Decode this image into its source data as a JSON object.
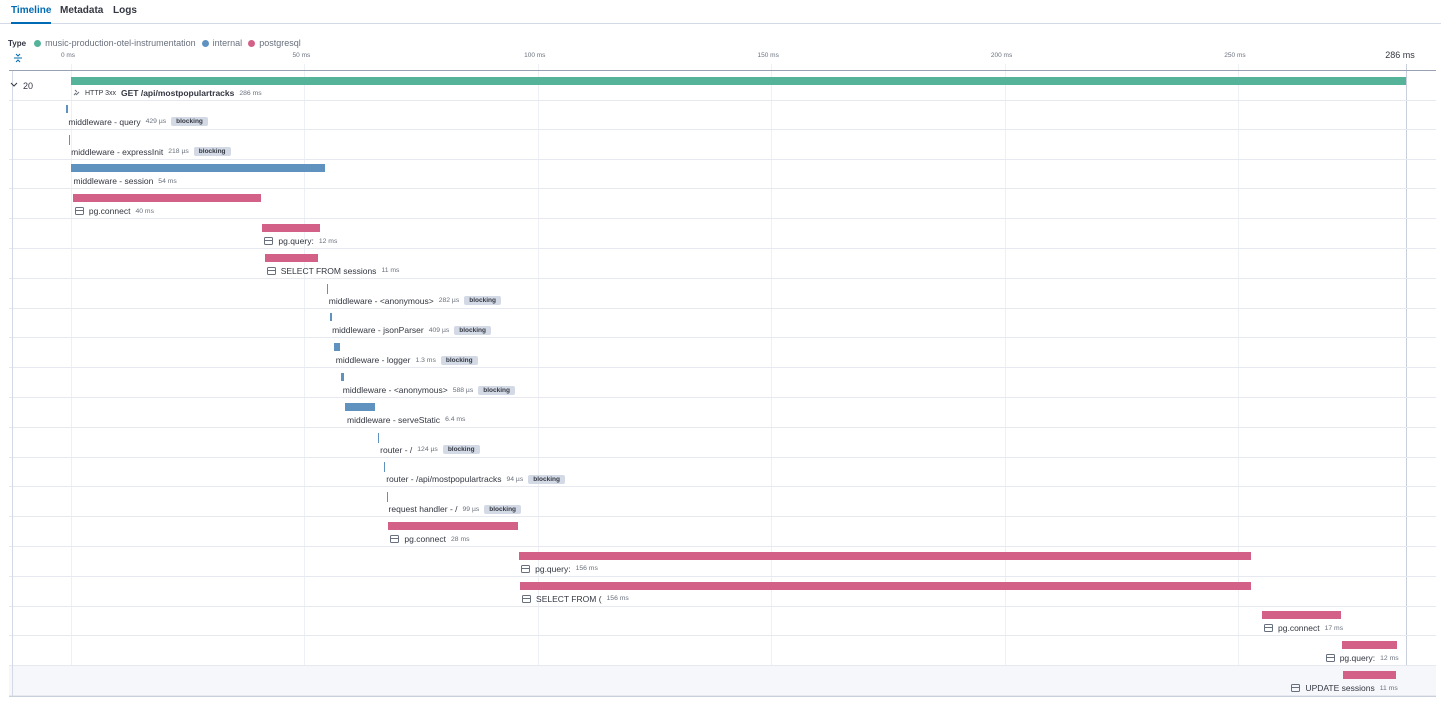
{
  "tabs": [
    {
      "label": "Timeline",
      "selected": true
    },
    {
      "label": "Metadata",
      "selected": false
    },
    {
      "label": "Logs",
      "selected": false
    }
  ],
  "legend": {
    "label": "Type",
    "items": [
      {
        "name": "music-production-otel-instrumentation",
        "color": "#54b399"
      },
      {
        "name": "internal",
        "color": "#6092c0"
      },
      {
        "name": "postgresql",
        "color": "#d36086"
      }
    ]
  },
  "colors": {
    "service": "#54b399",
    "internal": "#6092c0",
    "postgresql": "#d36086"
  },
  "timeline": {
    "total_ms": 286,
    "ticks": [
      {
        "label": "0 ms",
        "ms": 0
      },
      {
        "label": "50 ms",
        "ms": 50
      },
      {
        "label": "100 ms",
        "ms": 100
      },
      {
        "label": "150 ms",
        "ms": 150
      },
      {
        "label": "200 ms",
        "ms": 200
      },
      {
        "label": "250 ms",
        "ms": 250
      }
    ],
    "end_label": "286 ms"
  },
  "root_toggle": {
    "count": "20",
    "icon": "chevron-down-icon"
  },
  "spans": [
    {
      "name": "GET /api/mostpopulartracks",
      "status": "HTTP 3xx",
      "duration": "286 ms",
      "start_ms": 0,
      "duration_ms": 286,
      "type": "service",
      "icon": "http-icon",
      "blocking": false,
      "strong": true
    },
    {
      "name": "middleware - query",
      "duration": "429 µs",
      "start_ms": -1.0,
      "duration_ms": 0.429,
      "type": "internal",
      "icon": "",
      "blocking": true
    },
    {
      "name": "middleware - expressInit",
      "duration": "218 µs",
      "start_ms": -0.4,
      "duration_ms": 0.218,
      "type": "internal",
      "icon": "",
      "blocking": true
    },
    {
      "name": "middleware - session",
      "duration": "54 ms",
      "start_ms": 0.1,
      "duration_ms": 54.3,
      "type": "internal",
      "icon": "",
      "blocking": false
    },
    {
      "name": "pg.connect",
      "duration": "40 ms",
      "start_ms": 0.4,
      "duration_ms": 40.4,
      "type": "postgresql",
      "icon": "database-icon",
      "blocking": false
    },
    {
      "name": "pg.query:",
      "duration": "12 ms",
      "start_ms": 41.0,
      "duration_ms": 12.4,
      "type": "postgresql",
      "icon": "database-icon",
      "blocking": false
    },
    {
      "name": "SELECT FROM sessions",
      "duration": "11 ms",
      "start_ms": 41.5,
      "duration_ms": 11.4,
      "type": "postgresql",
      "icon": "database-icon",
      "blocking": false
    },
    {
      "name": "middleware - <anonymous>",
      "duration": "282 µs",
      "start_ms": 54.8,
      "duration_ms": 0.282,
      "type": "internal",
      "icon": "",
      "blocking": true
    },
    {
      "name": "middleware - jsonParser",
      "duration": "409 µs",
      "start_ms": 55.5,
      "duration_ms": 0.409,
      "type": "internal",
      "icon": "",
      "blocking": true
    },
    {
      "name": "middleware - logger",
      "duration": "1.3 ms",
      "start_ms": 56.3,
      "duration_ms": 1.3,
      "type": "internal",
      "icon": "",
      "blocking": true
    },
    {
      "name": "middleware - <anonymous>",
      "duration": "588 µs",
      "start_ms": 57.8,
      "duration_ms": 0.588,
      "type": "internal",
      "icon": "",
      "blocking": true
    },
    {
      "name": "middleware - serveStatic",
      "duration": "6.4 ms",
      "start_ms": 58.7,
      "duration_ms": 6.4,
      "type": "internal",
      "icon": "",
      "blocking": false
    },
    {
      "name": "router - /",
      "duration": "124 µs",
      "start_ms": 65.8,
      "duration_ms": 0.124,
      "type": "internal",
      "icon": "",
      "blocking": true
    },
    {
      "name": "router - /api/mostpopulartracks",
      "duration": "94 µs",
      "start_ms": 67.1,
      "duration_ms": 0.094,
      "type": "internal",
      "icon": "",
      "blocking": true
    },
    {
      "name": "request handler - /",
      "duration": "99 µs",
      "start_ms": 67.6,
      "duration_ms": 0.099,
      "type": "internal",
      "icon": "",
      "blocking": true
    },
    {
      "name": "pg.connect",
      "duration": "28 ms",
      "start_ms": 68.0,
      "duration_ms": 27.7,
      "type": "postgresql",
      "icon": "database-icon",
      "blocking": false
    },
    {
      "name": "pg.query:",
      "duration": "156 ms",
      "start_ms": 96.0,
      "duration_ms": 156.9,
      "type": "postgresql",
      "icon": "database-icon",
      "blocking": false
    },
    {
      "name": "SELECT FROM (",
      "duration": "156 ms",
      "start_ms": 96.2,
      "duration_ms": 156.5,
      "type": "postgresql",
      "icon": "database-icon",
      "blocking": false
    },
    {
      "name": "pg.connect",
      "duration": "17 ms",
      "start_ms": 255.1,
      "duration_ms": 17.0,
      "type": "postgresql",
      "icon": "database-icon",
      "blocking": false
    },
    {
      "name": "pg.query:",
      "duration": "12 ms",
      "start_ms": 272.2,
      "duration_ms": 11.8,
      "type": "postgresql",
      "icon": "database-icon",
      "blocking": false
    },
    {
      "name": "UPDATE sessions",
      "duration": "11 ms",
      "start_ms": 272.4,
      "duration_ms": 11.4,
      "type": "postgresql",
      "icon": "database-icon",
      "blocking": false
    }
  ],
  "badge_text": "blocking"
}
